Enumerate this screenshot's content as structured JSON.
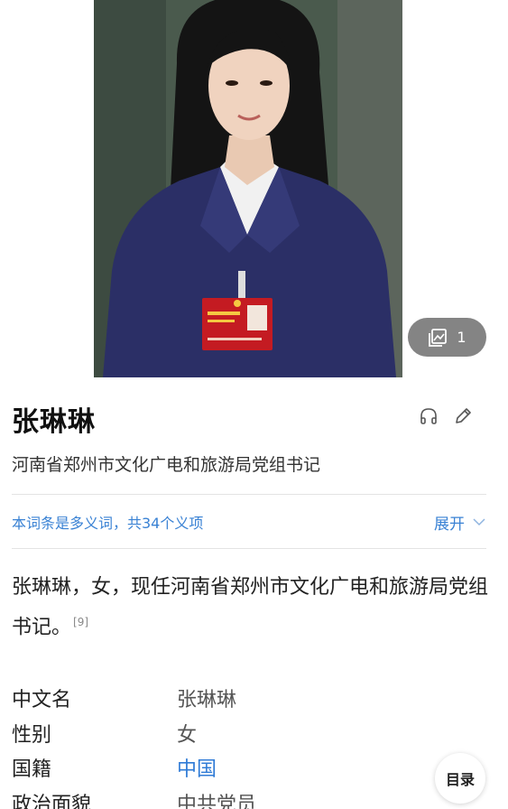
{
  "gallery": {
    "count": "1"
  },
  "entry": {
    "title": "张琳琳",
    "subtitle": "河南省郑州市文化广电和旅游局党组书记"
  },
  "polysemy": {
    "text": "本词条是多义词，共34个义项",
    "expand_label": "展开"
  },
  "summary": {
    "text": "张琳琳，女，现任河南省郑州市文化广电和旅游局党组书记。",
    "ref": "[9]"
  },
  "infobox": [
    {
      "key": "中文名",
      "value": "张琳琳"
    },
    {
      "key": "性别",
      "value": "女"
    },
    {
      "key": "国籍",
      "value": "中国"
    },
    {
      "key": "政治面貌",
      "value": "中共党员"
    }
  ],
  "toc": {
    "label": "目录"
  }
}
